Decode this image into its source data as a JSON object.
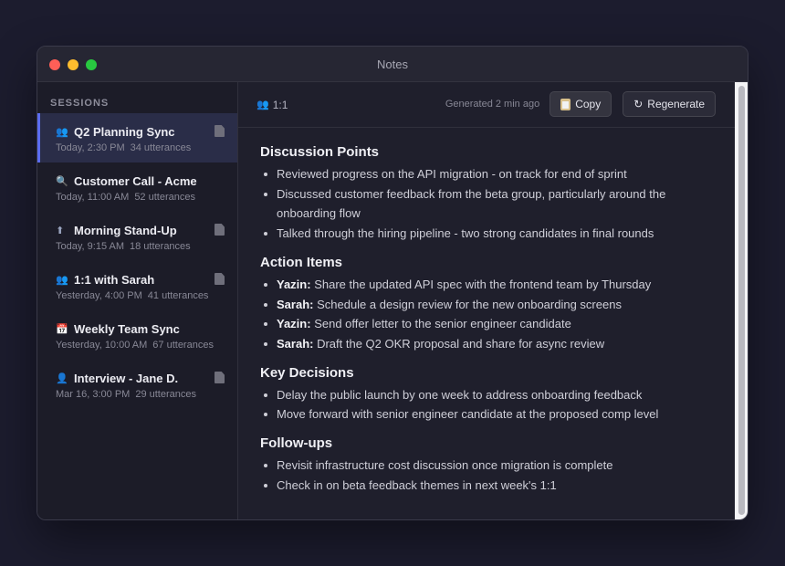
{
  "window": {
    "title": "Notes"
  },
  "sidebar": {
    "header": "SESSIONS",
    "sessions": [
      {
        "icon": "👥",
        "title": "Q2 Planning Sync",
        "time": "Today, 2:30 PM",
        "count": "34 utterances",
        "active": true,
        "doc": true
      },
      {
        "icon": "🔍",
        "title": "Customer Call - Acme",
        "time": "Today, 11:00 AM",
        "count": "52 utterances",
        "active": false,
        "doc": false
      },
      {
        "icon": "⬆",
        "title": "Morning Stand-Up",
        "time": "Today, 9:15 AM",
        "count": "18 utterances",
        "active": false,
        "doc": true
      },
      {
        "icon": "👥",
        "title": "1:1 with Sarah",
        "time": "Yesterday, 4:00 PM",
        "count": "41 utterances",
        "active": false,
        "doc": true
      },
      {
        "icon": "📅",
        "title": "Weekly Team Sync",
        "time": "Yesterday, 10:00 AM",
        "count": "67 utterances",
        "active": false,
        "doc": false
      },
      {
        "icon": "👤",
        "title": "Interview - Jane D.",
        "time": "Mar 16, 3:00 PM",
        "count": "29 utterances",
        "active": false,
        "doc": true
      }
    ]
  },
  "toolbar": {
    "icon": "👥",
    "label": "1:1",
    "generated": "Generated 2 min ago",
    "copy_label": "Copy",
    "regenerate_label": "Regenerate"
  },
  "notes": {
    "discussion": {
      "heading": "Discussion Points",
      "items": [
        "Reviewed progress on the API migration - on track for end of sprint",
        "Discussed customer feedback from the beta group, particularly around the onboarding flow",
        "Talked through the hiring pipeline - two strong candidates in final rounds"
      ]
    },
    "actions": {
      "heading": "Action Items",
      "items": [
        {
          "who": "Yazin:",
          "text": " Share the updated API spec with the frontend team by Thursday"
        },
        {
          "who": "Sarah:",
          "text": " Schedule a design review for the new onboarding screens"
        },
        {
          "who": "Yazin:",
          "text": " Send offer letter to the senior engineer candidate"
        },
        {
          "who": "Sarah:",
          "text": " Draft the Q2 OKR proposal and share for async review"
        }
      ]
    },
    "decisions": {
      "heading": "Key Decisions",
      "items": [
        "Delay the public launch by one week to address onboarding feedback",
        "Move forward with senior engineer candidate at the proposed comp level"
      ]
    },
    "followups": {
      "heading": "Follow-ups",
      "items": [
        "Revisit infrastructure cost discussion once migration is complete",
        "Check in on beta feedback themes in next week's 1:1"
      ]
    }
  },
  "colors": {
    "accent": "#5b6cf0",
    "active_row": "#2a2d48",
    "background": "#1c1c2e"
  }
}
